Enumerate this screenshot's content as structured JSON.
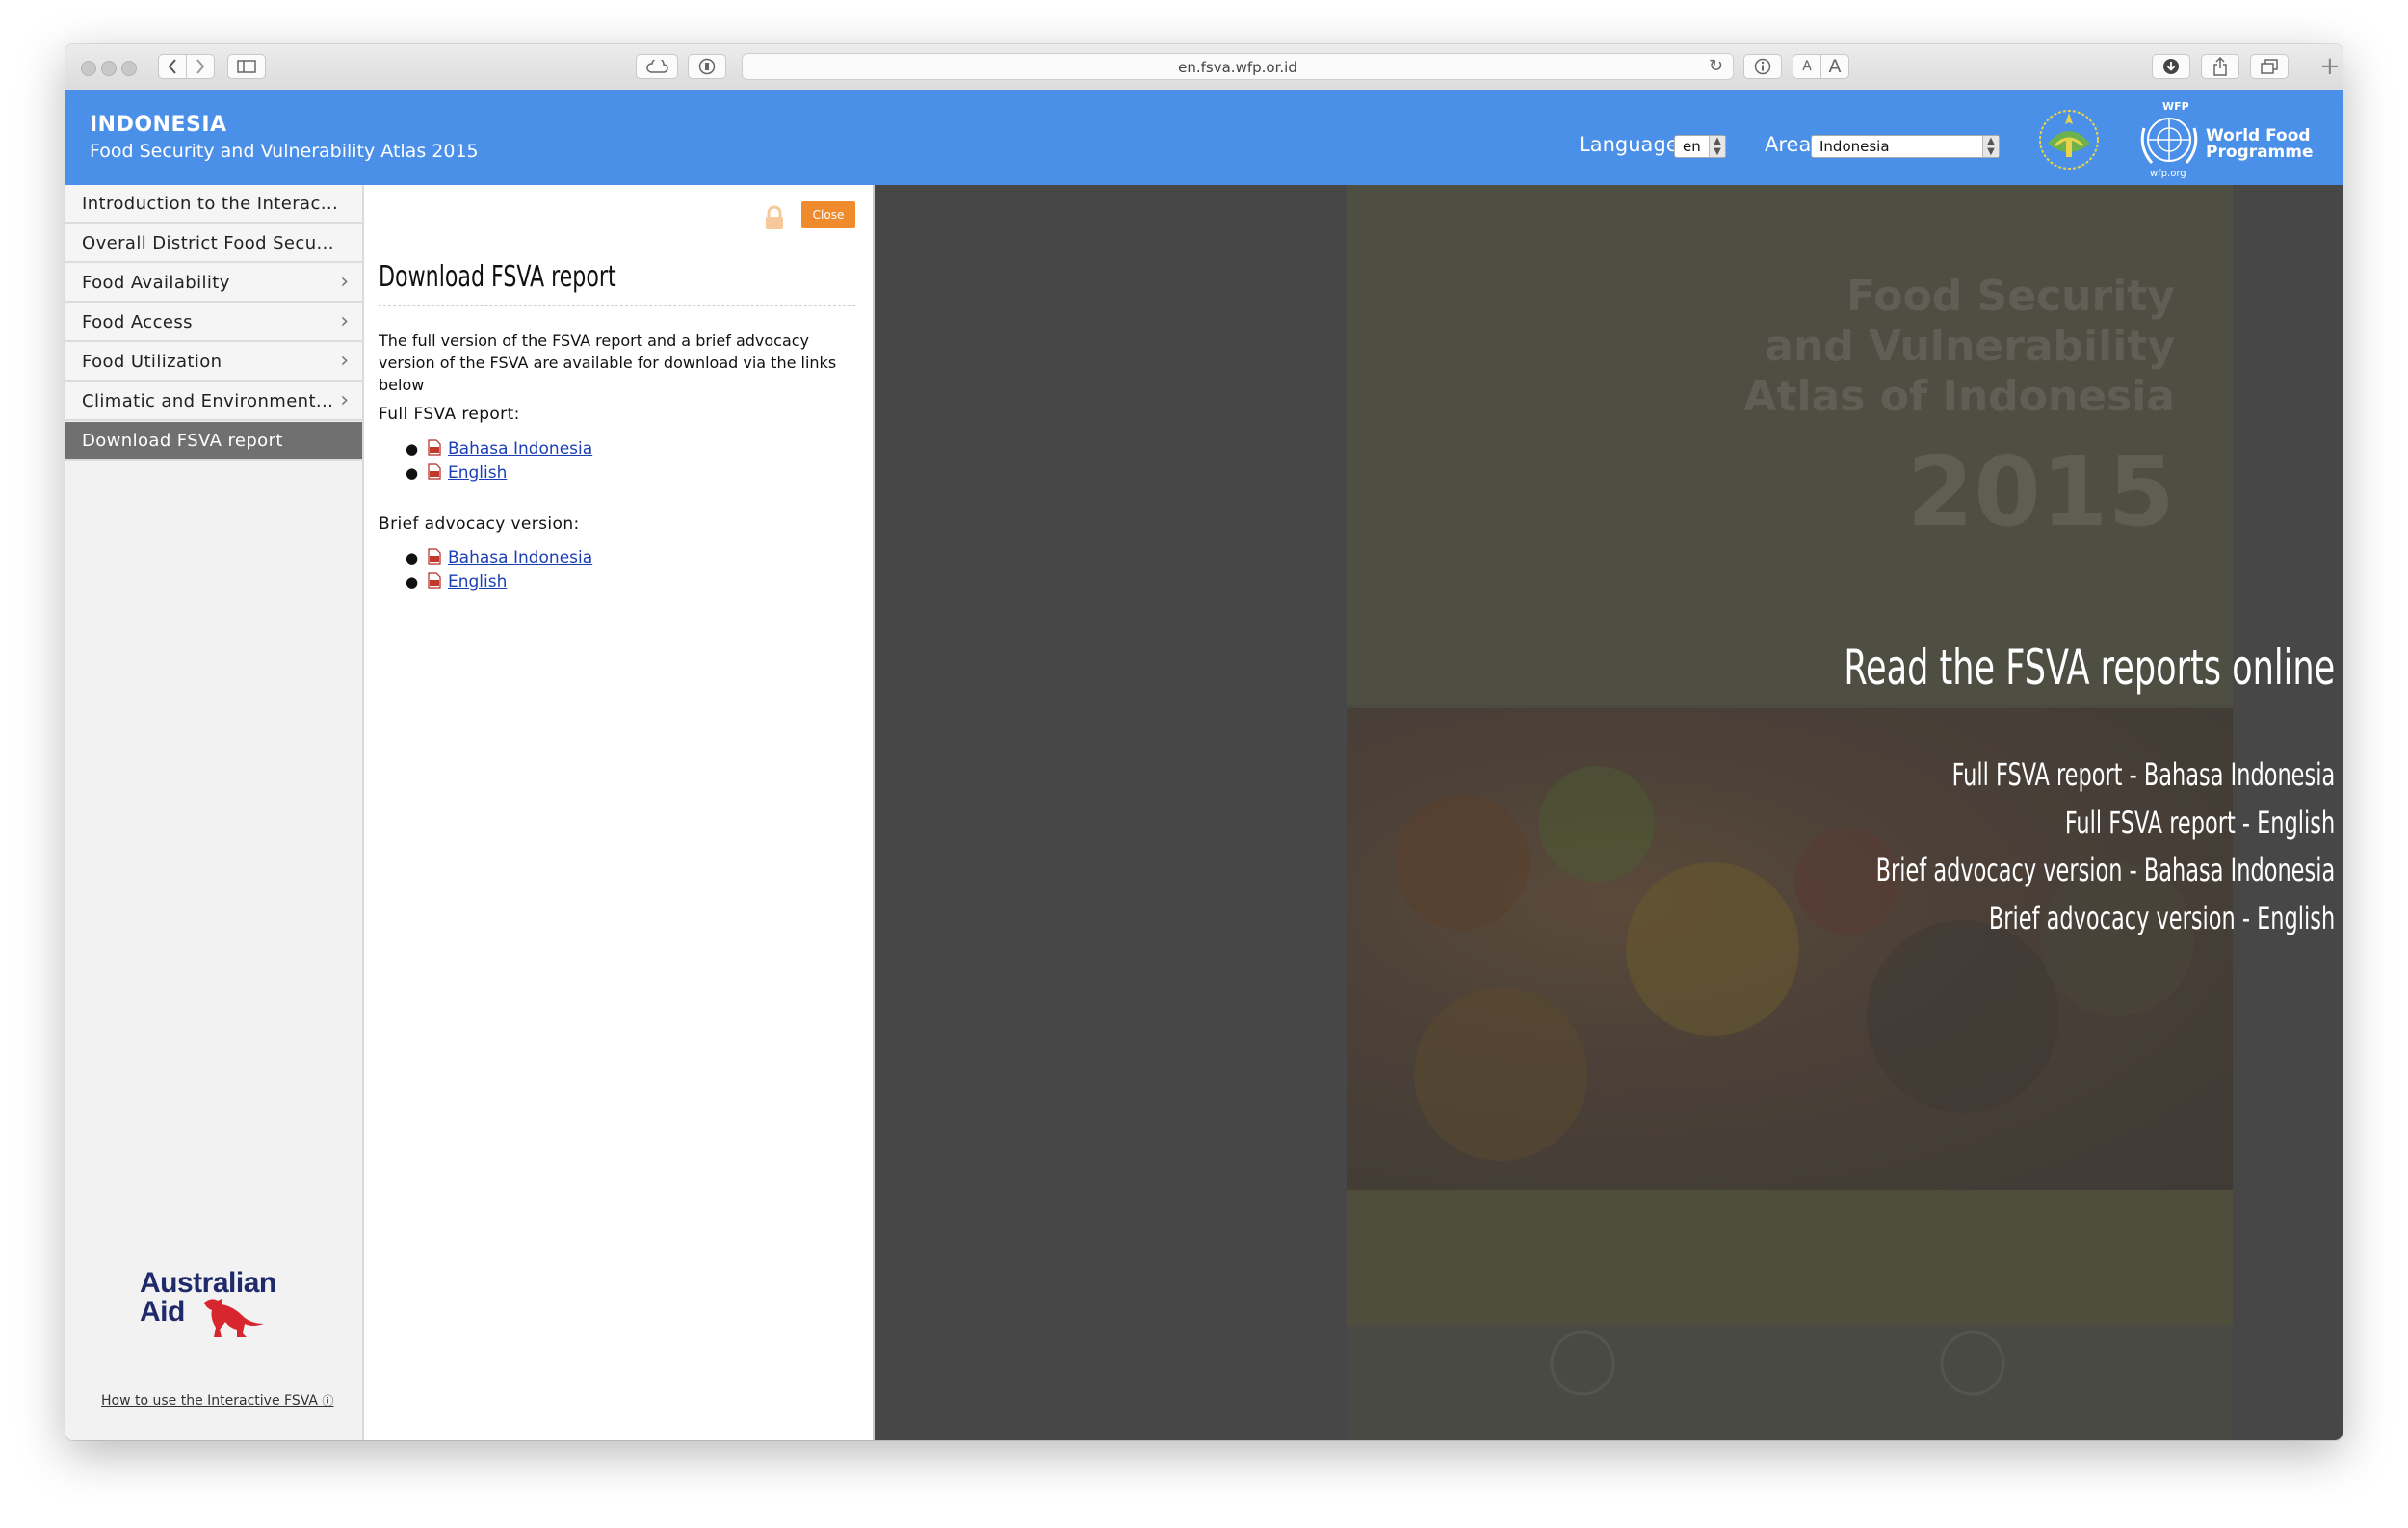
{
  "browser": {
    "url": "en.fsva.wfp.or.id",
    "font_small_label": "A",
    "font_large_label": "A"
  },
  "header": {
    "country": "INDONESIA",
    "subtitle": "Food Security and Vulnerability Atlas 2015",
    "language_label": "Language",
    "language_value": "en",
    "area_label": "Area",
    "area_value": "Indonesia",
    "wfp_line1": "World Food",
    "wfp_line2": "Programme",
    "wfp_abbr": "WFP",
    "wfp_site": "wfp.org",
    "accent_color": "#4a90e8"
  },
  "sidebar": {
    "items": [
      {
        "label": "Introduction to the Interac...",
        "has_chevron": false
      },
      {
        "label": "Overall District Food Secu...",
        "has_chevron": false
      },
      {
        "label": "Food Availability",
        "has_chevron": true
      },
      {
        "label": "Food Access",
        "has_chevron": true
      },
      {
        "label": "Food Utilization",
        "has_chevron": true
      },
      {
        "label": "Climatic and Environment...",
        "has_chevron": true
      },
      {
        "label": "Download FSVA report",
        "has_chevron": false,
        "active": true
      }
    ],
    "sponsor_line1": "Australian",
    "sponsor_line2": "Aid",
    "help_link": "How to use the Interactive FSVA"
  },
  "panel": {
    "close_label": "Close",
    "title": "Download FSVA report",
    "description": "The full version of the FSVA report and a brief advocacy version of the FSVA are available for download via the links below",
    "full_heading": "Full FSVA report:",
    "full_links": [
      "Bahasa Indonesia",
      "English"
    ],
    "brief_heading": "Brief advocacy version:",
    "brief_links": [
      "Bahasa Indonesia",
      "English"
    ]
  },
  "content": {
    "cover_title_1": "Food Security",
    "cover_title_2": "and Vulnerability",
    "cover_title_3": "Atlas of Indonesia",
    "cover_year": "2015",
    "headline": "Read the FSVA reports online",
    "links": [
      "Full FSVA report - Bahasa Indonesia",
      "Full FSVA report - English",
      "Brief advocacy version - Bahasa Indonesia",
      "Brief advocacy version - English"
    ]
  }
}
